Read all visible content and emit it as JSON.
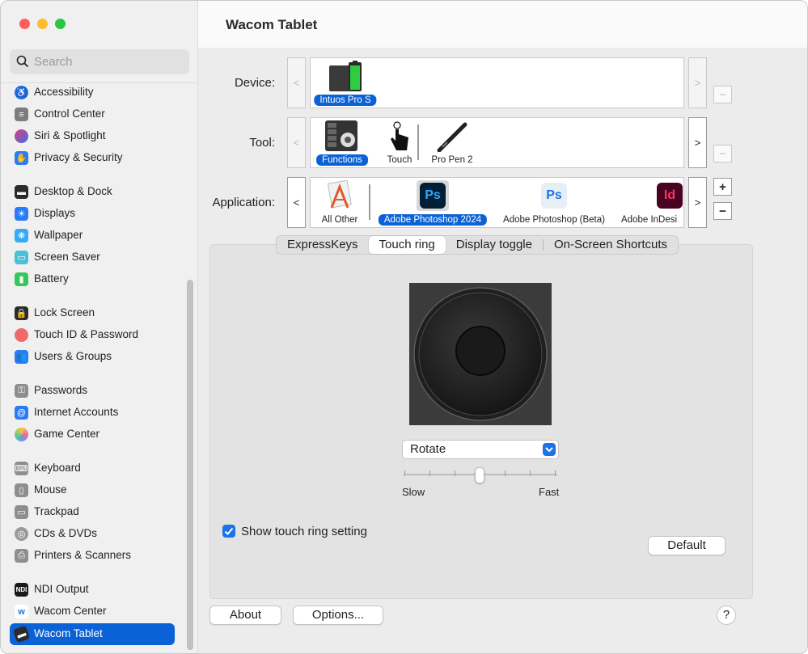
{
  "window": {
    "title": "Wacom Tablet"
  },
  "search": {
    "placeholder": "Search"
  },
  "sidebar": {
    "items": [
      {
        "label": "Accessibility",
        "icon": "accessibility-icon",
        "color": "#1a73e8"
      },
      {
        "label": "Control Center",
        "icon": "control-center-icon",
        "color": "#7d7d7d"
      },
      {
        "label": "Siri & Spotlight",
        "icon": "siri-icon",
        "color": "#b04be0"
      },
      {
        "label": "Privacy & Security",
        "icon": "hand-icon",
        "color": "#2a7cf5"
      },
      {
        "label": "Desktop & Dock",
        "icon": "dock-icon",
        "color": "#2b2b2b"
      },
      {
        "label": "Displays",
        "icon": "sun-icon",
        "color": "#2a7cf5"
      },
      {
        "label": "Wallpaper",
        "icon": "wallpaper-icon",
        "color": "#38a9f5"
      },
      {
        "label": "Screen Saver",
        "icon": "screen-saver-icon",
        "color": "#4cc0d9"
      },
      {
        "label": "Battery",
        "icon": "battery-icon",
        "color": "#34c759"
      },
      {
        "label": "Lock Screen",
        "icon": "lock-icon",
        "color": "#2b2b2b"
      },
      {
        "label": "Touch ID & Password",
        "icon": "fingerprint-icon",
        "color": "#f06a6a"
      },
      {
        "label": "Users & Groups",
        "icon": "users-icon",
        "color": "#2a7cf5"
      },
      {
        "label": "Passwords",
        "icon": "key-icon",
        "color": "#8e8e8e"
      },
      {
        "label": "Internet Accounts",
        "icon": "at-icon",
        "color": "#2a7cf5"
      },
      {
        "label": "Game Center",
        "icon": "game-center-icon",
        "color": "#e0a030"
      },
      {
        "label": "Keyboard",
        "icon": "keyboard-icon",
        "color": "#8e8e8e"
      },
      {
        "label": "Mouse",
        "icon": "mouse-icon",
        "color": "#8e8e8e"
      },
      {
        "label": "Trackpad",
        "icon": "trackpad-icon",
        "color": "#8e8e8e"
      },
      {
        "label": "CDs & DVDs",
        "icon": "disc-icon",
        "color": "#9a9a9a"
      },
      {
        "label": "Printers & Scanners",
        "icon": "printer-icon",
        "color": "#8e8e8e"
      },
      {
        "label": "NDI Output",
        "icon": "ndi-icon",
        "color": "#1a1a1a"
      },
      {
        "label": "Wacom Center",
        "icon": "wacom-center-icon",
        "color": "#ffffff"
      },
      {
        "label": "Wacom Tablet",
        "icon": "wacom-tablet-icon",
        "color": "#2b2b2b"
      }
    ]
  },
  "device": {
    "label": "Device:",
    "items": [
      {
        "name": "Intuos Pro S"
      }
    ]
  },
  "tool": {
    "label": "Tool:",
    "items": [
      {
        "name": "Functions"
      },
      {
        "name": "Touch"
      },
      {
        "name": "Pro Pen 2"
      }
    ]
  },
  "application": {
    "label": "Application:",
    "items": [
      {
        "name": "All Other"
      },
      {
        "name": "Adobe Photoshop 2024"
      },
      {
        "name": "Adobe Photoshop (Beta)"
      },
      {
        "name": "Adobe InDesi"
      }
    ]
  },
  "tabs": [
    {
      "label": "ExpressKeys"
    },
    {
      "label": "Touch ring"
    },
    {
      "label": "Display toggle"
    },
    {
      "label": "On-Screen Shortcuts"
    }
  ],
  "ring": {
    "function": "Rotate",
    "speed_slow": "Slow",
    "speed_fast": "Fast",
    "speed_position": 0.5
  },
  "show_setting": {
    "label": "Show touch ring setting",
    "checked": true
  },
  "buttons": {
    "default": "Default",
    "about": "About",
    "options": "Options...",
    "help": "?",
    "add": "+",
    "remove": "−",
    "prev": "<",
    "next": ">"
  }
}
